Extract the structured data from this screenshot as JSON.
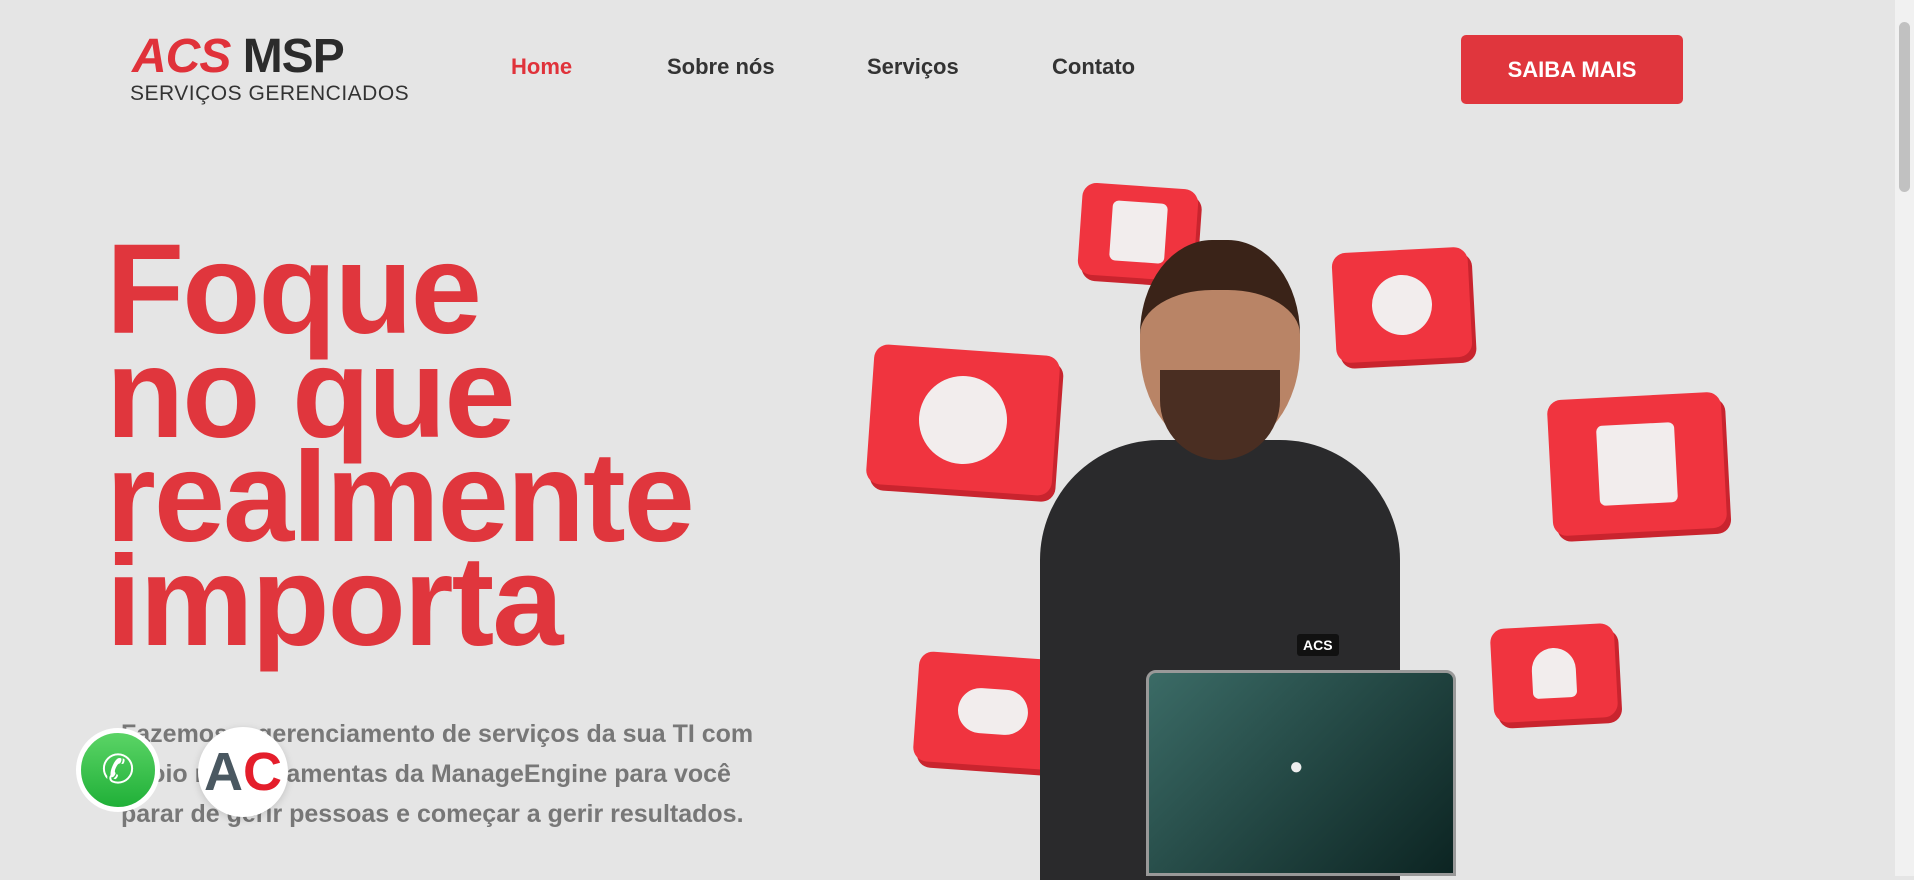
{
  "logo": {
    "acs": "ACS",
    "msp": "MSP",
    "tagline": "SERVIÇOS GERENCIADOS"
  },
  "nav": {
    "items": [
      {
        "label": "Home",
        "active": true
      },
      {
        "label": "Sobre nós",
        "active": false
      },
      {
        "label": "Serviços",
        "active": false
      },
      {
        "label": "Contato",
        "active": false
      }
    ]
  },
  "cta_label": "SAIBA MAIS",
  "hero": {
    "headline": [
      "Foque",
      "no que",
      "realmente",
      "importa"
    ],
    "lead": "Fazemos o gerenciamento de serviços da sua TI com apoio nas ferramentas da ManageEngine para você parar de gerir pessoas e começar a gerir resultados.",
    "vest_logo": "ACS"
  },
  "floating": {
    "chat_badge": [
      "A",
      "C"
    ]
  },
  "colors": {
    "accent": "#e0363d",
    "background": "#e5e5e5",
    "text": "#333333",
    "lead": "#777777"
  }
}
